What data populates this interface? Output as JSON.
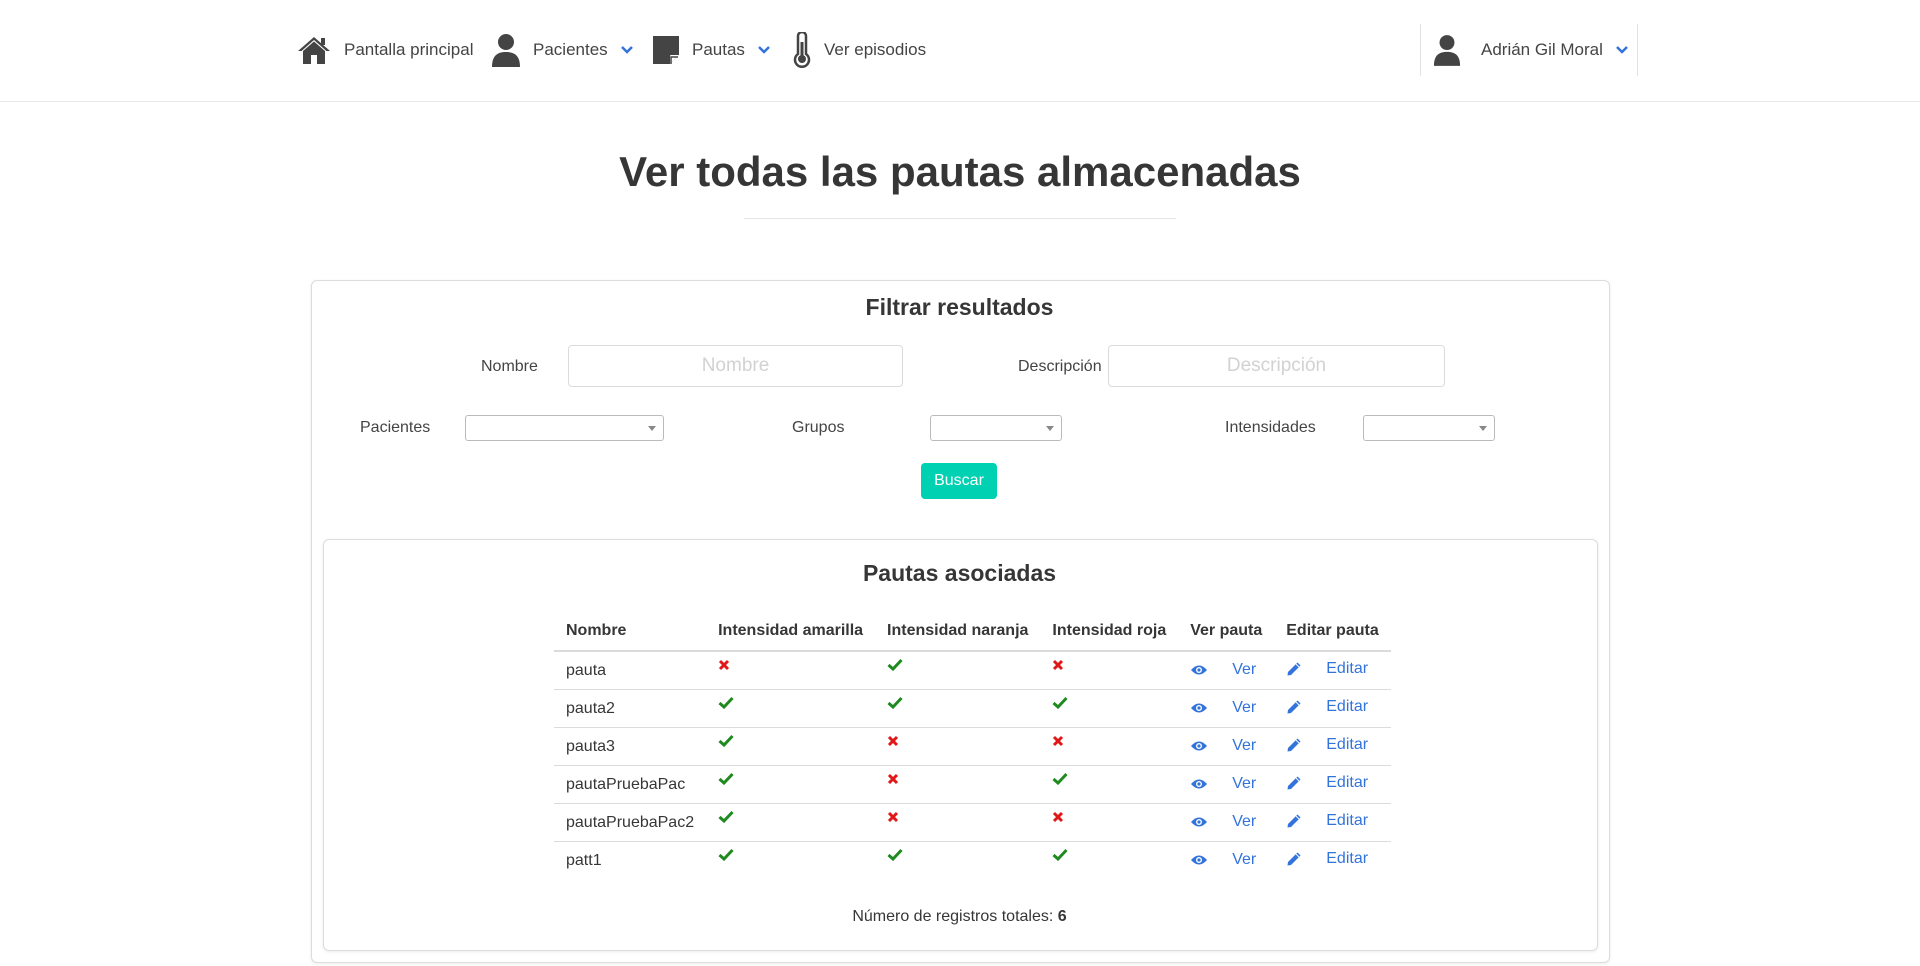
{
  "nav": {
    "home": "Pantalla principal",
    "patients": "Pacientes",
    "guidelines": "Pautas",
    "episodes": "Ver episodios",
    "user": "Adrián Gil Moral"
  },
  "page": {
    "title": "Ver todas las pautas almacenadas"
  },
  "filter": {
    "title": "Filtrar resultados",
    "name_label": "Nombre",
    "name_placeholder": "Nombre",
    "name_value": "",
    "description_label": "Descripción",
    "description_placeholder": "Descripción",
    "description_value": "",
    "patients_label": "Pacientes",
    "patients_value": "",
    "groups_label": "Grupos",
    "groups_value": "",
    "intensities_label": "Intensidades",
    "intensities_value": "",
    "search_button": "Buscar"
  },
  "results": {
    "title": "Pautas asociadas",
    "columns": [
      "Nombre",
      "Intensidad amarilla",
      "Intensidad naranja",
      "Intensidad roja",
      "Ver pauta",
      "Editar pauta"
    ],
    "view_label": "Ver",
    "edit_label": "Editar",
    "rows": [
      {
        "name": "pauta",
        "yellow": false,
        "orange": true,
        "red": false
      },
      {
        "name": "pauta2",
        "yellow": true,
        "orange": true,
        "red": true
      },
      {
        "name": "pauta3",
        "yellow": true,
        "orange": false,
        "red": false
      },
      {
        "name": "pautaPruebaPac",
        "yellow": true,
        "orange": false,
        "red": true
      },
      {
        "name": "pautaPruebaPac2",
        "yellow": true,
        "orange": false,
        "red": false
      },
      {
        "name": "patt1",
        "yellow": true,
        "orange": true,
        "red": true
      }
    ],
    "total_label": "Número de registros totales:",
    "total_value": "6"
  },
  "colors": {
    "accent": "#00d1b2",
    "link": "#3273dc",
    "check": "#1f8a1f",
    "cross": "#e01818"
  },
  "icons": {
    "home": "home-icon",
    "patients": "user-icon",
    "guidelines": "sticky-note-icon",
    "episodes": "thermometer-icon",
    "user": "user-icon",
    "dropdown": "chevron-down-icon",
    "yes": "check-icon",
    "no": "cross-icon",
    "view": "eye-icon",
    "edit": "pencil-icon"
  }
}
